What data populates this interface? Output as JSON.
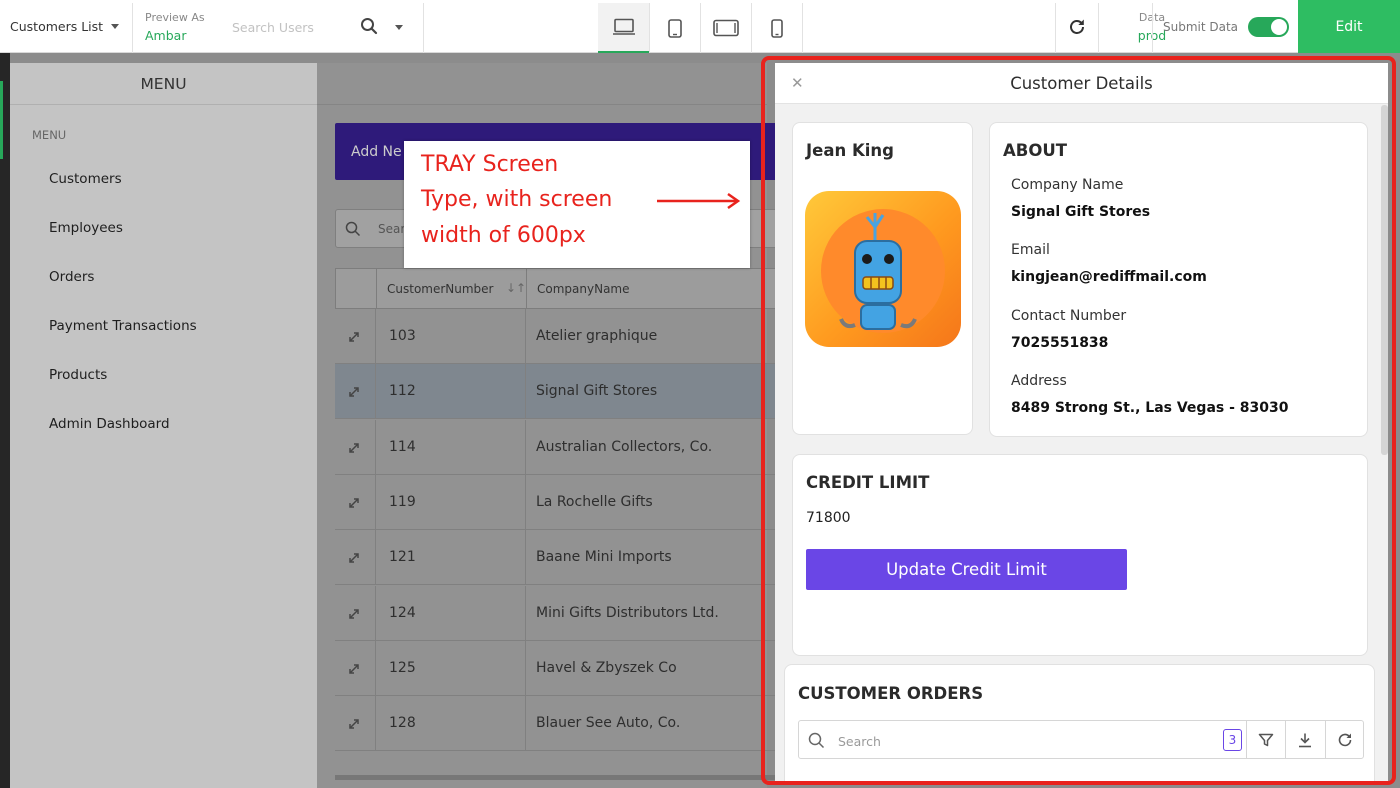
{
  "topbar": {
    "project_name": "Customers List",
    "preview_as_label": "Preview As",
    "preview_as_user": "Ambar",
    "search_users_placeholder": "Search Users",
    "devices": [
      "desktop-icon",
      "tablet-portrait-icon",
      "tablet-landscape-icon",
      "mobile-icon"
    ],
    "data_label": "Data",
    "data_env": "prod",
    "submit_data_label": "Submit Data",
    "submit_data_enabled": true,
    "edit_label": "Edit"
  },
  "menu": {
    "header": "MENU",
    "section_label": "MENU",
    "items": [
      {
        "label": "Customers"
      },
      {
        "label": "Employees"
      },
      {
        "label": "Orders"
      },
      {
        "label": "Payment Transactions"
      },
      {
        "label": "Products"
      },
      {
        "label": "Admin Dashboard"
      }
    ]
  },
  "main": {
    "add_button_label": "Add Ne",
    "search_partial": "Sear",
    "grid": {
      "columns": [
        "CustomerNumber",
        "CompanyName"
      ],
      "rows": [
        {
          "number": "103",
          "company": "Atelier graphique"
        },
        {
          "number": "112",
          "company": "Signal Gift Stores",
          "selected": true
        },
        {
          "number": "114",
          "company": "Australian Collectors, Co."
        },
        {
          "number": "119",
          "company": "La Rochelle Gifts"
        },
        {
          "number": "121",
          "company": "Baane Mini Imports"
        },
        {
          "number": "124",
          "company": "Mini Gifts Distributors Ltd."
        },
        {
          "number": "125",
          "company": "Havel & Zbyszek Co"
        },
        {
          "number": "128",
          "company": "Blauer See Auto, Co."
        }
      ]
    }
  },
  "annotation": {
    "lines": [
      "TRAY Screen",
      "Type, with screen",
      "width of 600px"
    ],
    "color": "#e8231d"
  },
  "tray": {
    "title": "Customer Details",
    "customer_name": "Jean King",
    "about": {
      "title": "ABOUT",
      "fields": [
        {
          "label": "Company Name",
          "value": "Signal Gift Stores"
        },
        {
          "label": "Email",
          "value": "kingjean@rediffmail.com"
        },
        {
          "label": "Contact Number",
          "value": "7025551838"
        },
        {
          "label": "Address",
          "value": "8489 Strong St., Las Vegas - 83030"
        }
      ]
    },
    "credit": {
      "title": "CREDIT LIMIT",
      "amount": "71800",
      "button_label": "Update Credit Limit"
    },
    "orders": {
      "title": "CUSTOMER ORDERS",
      "search_placeholder": "Search",
      "filter_count": "3"
    }
  },
  "colors": {
    "accent_green": "#2ebd62",
    "primary_purple": "#6a46e6",
    "annotation_red": "#e8231d"
  }
}
